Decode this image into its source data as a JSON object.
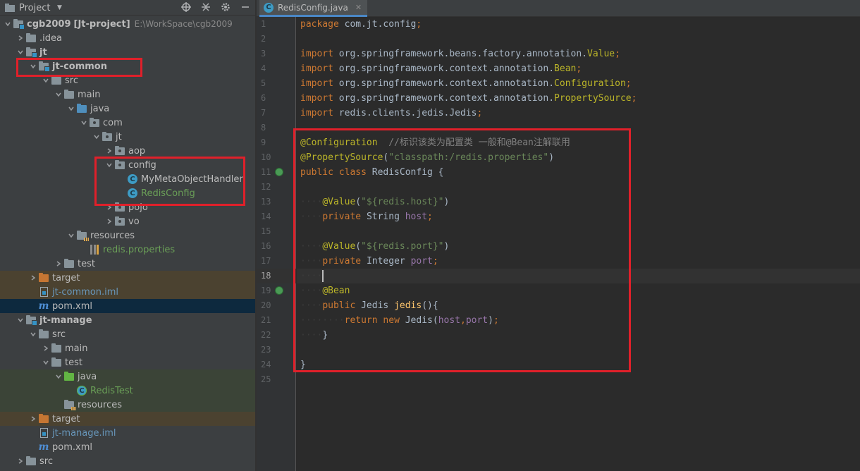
{
  "project_panel": {
    "title": "Project",
    "toolbar_icons": [
      "target-icon",
      "collapse-icon",
      "gear-icon",
      "minimize-icon"
    ],
    "tree": [
      {
        "label": "cgb2009",
        "extra": "[Jt-project]",
        "path": "E:\\WorkSpace\\cgb2009",
        "icon": "module-folder",
        "expanded": true
      },
      {
        "label": ".idea",
        "icon": "folder",
        "expanded": false
      },
      {
        "label": "jt",
        "icon": "module-folder",
        "expanded": true
      },
      {
        "label": "jt-common",
        "icon": "module-folder",
        "expanded": true
      },
      {
        "label": "src",
        "icon": "folder",
        "expanded": true
      },
      {
        "label": "main",
        "icon": "folder",
        "expanded": true
      },
      {
        "label": "java",
        "icon": "source-folder",
        "expanded": true
      },
      {
        "label": "com",
        "icon": "package",
        "expanded": true
      },
      {
        "label": "jt",
        "icon": "package",
        "expanded": true
      },
      {
        "label": "aop",
        "icon": "package",
        "expanded": false
      },
      {
        "label": "config",
        "icon": "package",
        "expanded": true
      },
      {
        "label": "MyMetaObjectHandler",
        "icon": "class"
      },
      {
        "label": "RedisConfig",
        "icon": "class"
      },
      {
        "label": "pojo",
        "icon": "package",
        "expanded": false
      },
      {
        "label": "vo",
        "icon": "package",
        "expanded": false
      },
      {
        "label": "resources",
        "icon": "resources-folder",
        "expanded": true
      },
      {
        "label": "redis.properties",
        "icon": "properties-file"
      },
      {
        "label": "test",
        "icon": "folder",
        "expanded": false
      },
      {
        "label": "target",
        "icon": "excluded-folder",
        "expanded": false
      },
      {
        "label": "jt-common.iml",
        "icon": "iml-file"
      },
      {
        "label": "pom.xml",
        "icon": "maven-file"
      },
      {
        "label": "jt-manage",
        "icon": "module-folder",
        "expanded": true
      },
      {
        "label": "src",
        "icon": "folder",
        "expanded": true
      },
      {
        "label": "main",
        "icon": "folder",
        "expanded": false
      },
      {
        "label": "test",
        "icon": "folder",
        "expanded": true
      },
      {
        "label": "java",
        "icon": "test-folder",
        "expanded": true
      },
      {
        "label": "RedisTest",
        "icon": "test-class"
      },
      {
        "label": "resources",
        "icon": "resources-folder"
      },
      {
        "label": "target",
        "icon": "excluded-folder",
        "expanded": false
      },
      {
        "label": "jt-manage.iml",
        "icon": "iml-file"
      },
      {
        "label": "pom.xml",
        "icon": "maven-file"
      },
      {
        "label": "src",
        "icon": "folder",
        "expanded": false
      }
    ]
  },
  "editor": {
    "tab": {
      "label": "RedisConfig.java",
      "icon": "class-icon"
    },
    "current_line": 18,
    "lines": [
      {
        "n": "1",
        "tokens": [
          [
            "kw",
            "package"
          ],
          [
            "id",
            " com.jt.config"
          ],
          [
            "kw",
            ";"
          ]
        ]
      },
      {
        "n": "2",
        "tokens": []
      },
      {
        "n": "3",
        "tokens": [
          [
            "kw",
            "import"
          ],
          [
            "id",
            " org.springframework.beans.factory.annotation."
          ],
          [
            "ann",
            "Value"
          ],
          [
            "kw",
            ";"
          ]
        ]
      },
      {
        "n": "4",
        "tokens": [
          [
            "kw",
            "import"
          ],
          [
            "id",
            " org.springframework.context.annotation."
          ],
          [
            "ann",
            "Bean"
          ],
          [
            "kw",
            ";"
          ]
        ]
      },
      {
        "n": "5",
        "tokens": [
          [
            "kw",
            "import"
          ],
          [
            "id",
            " org.springframework.context.annotation."
          ],
          [
            "ann",
            "Configuration"
          ],
          [
            "kw",
            ";"
          ]
        ]
      },
      {
        "n": "6",
        "tokens": [
          [
            "kw",
            "import"
          ],
          [
            "id",
            " org.springframework.context.annotation."
          ],
          [
            "ann",
            "PropertySource"
          ],
          [
            "kw",
            ";"
          ]
        ]
      },
      {
        "n": "7",
        "tokens": [
          [
            "kw",
            "import"
          ],
          [
            "id",
            " redis.clients.jedis.Jedis"
          ],
          [
            "kw",
            ";"
          ]
        ]
      },
      {
        "n": "8",
        "tokens": []
      },
      {
        "n": "9",
        "tokens": [
          [
            "ann",
            "@Configuration"
          ],
          [
            "id",
            "  "
          ],
          [
            "cmt",
            "//标识该类为配置类 一般和@Bean注解联用"
          ]
        ]
      },
      {
        "n": "10",
        "tokens": [
          [
            "ann",
            "@PropertySource"
          ],
          [
            "id",
            "("
          ],
          [
            "str",
            "\"classpath:/redis.properties\""
          ],
          [
            "id",
            ")"
          ]
        ]
      },
      {
        "n": "11",
        "tokens": [
          [
            "kw",
            "public class "
          ],
          [
            "id",
            "RedisConfig {"
          ]
        ]
      },
      {
        "n": "12",
        "tokens": []
      },
      {
        "n": "13",
        "tokens": [
          [
            "ws",
            "····"
          ],
          [
            "ann",
            "@Value"
          ],
          [
            "id",
            "("
          ],
          [
            "str",
            "\"${redis.host}\""
          ],
          [
            "id",
            ")"
          ]
        ]
      },
      {
        "n": "14",
        "tokens": [
          [
            "ws",
            "····"
          ],
          [
            "kw",
            "private "
          ],
          [
            "id",
            "String "
          ],
          [
            "fld",
            "host"
          ],
          [
            "kw",
            ";"
          ]
        ]
      },
      {
        "n": "15",
        "tokens": []
      },
      {
        "n": "16",
        "tokens": [
          [
            "ws",
            "····"
          ],
          [
            "ann",
            "@Value"
          ],
          [
            "id",
            "("
          ],
          [
            "str",
            "\"${redis.port}\""
          ],
          [
            "id",
            ")"
          ]
        ]
      },
      {
        "n": "17",
        "tokens": [
          [
            "ws",
            "····"
          ],
          [
            "kw",
            "private "
          ],
          [
            "id",
            "Integer "
          ],
          [
            "fld",
            "port"
          ],
          [
            "kw",
            ";"
          ]
        ]
      },
      {
        "n": "18",
        "tokens": [
          [
            "ws",
            "····"
          ]
        ]
      },
      {
        "n": "19",
        "tokens": [
          [
            "ws",
            "····"
          ],
          [
            "ann",
            "@Bean"
          ]
        ]
      },
      {
        "n": "20",
        "tokens": [
          [
            "ws",
            "····"
          ],
          [
            "kw",
            "public "
          ],
          [
            "id",
            "Jedis "
          ],
          [
            "fn",
            "jedis"
          ],
          [
            "id",
            "(){"
          ]
        ]
      },
      {
        "n": "21",
        "tokens": [
          [
            "ws",
            "········"
          ],
          [
            "kw",
            "return new "
          ],
          [
            "id",
            "Jedis("
          ],
          [
            "fld",
            "host"
          ],
          [
            "kw",
            ","
          ],
          [
            "fld",
            "port"
          ],
          [
            "id",
            ")"
          ],
          [
            "kw",
            ";"
          ]
        ]
      },
      {
        "n": "22",
        "tokens": [
          [
            "ws",
            "····"
          ],
          [
            "id",
            "}"
          ]
        ]
      },
      {
        "n": "23",
        "tokens": []
      },
      {
        "n": "24",
        "tokens": [
          [
            "id",
            "}"
          ]
        ]
      },
      {
        "n": "25",
        "tokens": []
      }
    ]
  },
  "colors": {
    "panel_bg": "#3c3f41",
    "editor_bg": "#2b2b2b",
    "annotation_red": "#e0202a",
    "keyword": "#cc7832",
    "annotation": "#bbb529",
    "string": "#6a8759"
  }
}
